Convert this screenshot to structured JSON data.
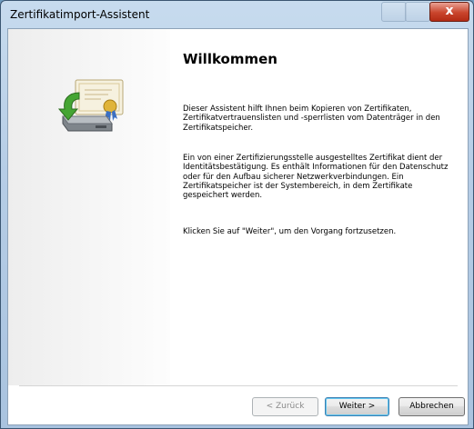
{
  "window": {
    "title": "Zertifikatimport-Assistent",
    "close_glyph": "x"
  },
  "page": {
    "heading": "Willkommen",
    "paragraphs": [
      "Dieser Assistent hilft Ihnen beim Kopieren von Zertifikaten, Zertifikatvertrauenslisten und -sperrlisten vom Datenträger in den Zertifikatspeicher.",
      "Ein von einer Zertifizierungsstelle ausgestelltes Zertifikat dient der Identitätsbestätigung. Es enthält Informationen für den Datenschutz oder für den Aufbau sicherer Netzwerkverbindungen. Ein Zertifikatspeicher ist der Systembereich, in dem Zertifikate gespeichert werden.",
      "Klicken Sie auf \"Weiter\", um den Vorgang fortzusetzen."
    ],
    "icon": "certificate-import-icon"
  },
  "buttons": {
    "back": "< Zurück",
    "next": "Weiter >",
    "cancel": "Abbrechen"
  },
  "colors": {
    "close_button": "#c9442c",
    "default_button_border": "#3c7fb1"
  }
}
